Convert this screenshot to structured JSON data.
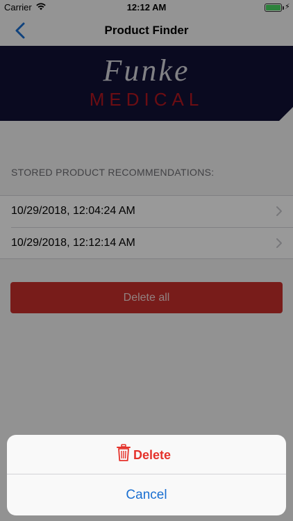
{
  "status_bar": {
    "carrier": "Carrier",
    "time": "12:12 AM",
    "icons": [
      "wifi-icon",
      "battery-icon",
      "charging-icon"
    ]
  },
  "nav": {
    "title": "Product Finder",
    "back_icon": "chevron-left-icon"
  },
  "banner": {
    "logo_line1": "Funke",
    "logo_line2": "MEDICAL",
    "background_color": "#121236",
    "accent_color": "#b31620"
  },
  "recommendations": {
    "header": "STORED PRODUCT RECOMMENDATIONS:",
    "items": [
      {
        "label": "10/29/2018, 12:04:24 AM"
      },
      {
        "label": "10/29/2018, 12:12:14 AM"
      }
    ]
  },
  "delete_all": {
    "label": "Delete all",
    "color": "#c9302c"
  },
  "action_sheet": {
    "delete_label": "Delete",
    "delete_icon": "trash-icon",
    "cancel_label": "Cancel",
    "destructive_color": "#e5322b",
    "cancel_color": "#1a6fd1"
  }
}
